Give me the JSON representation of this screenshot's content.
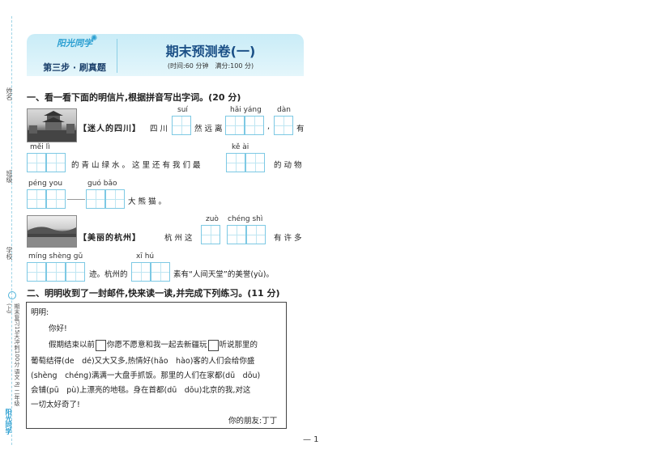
{
  "margin": {
    "name_label": "姓名",
    "class_label": "班级",
    "school_label": "学校",
    "brand": "阳光同学",
    "book_title": "期末复习15天冲刺100分 语文 RJ 二年级(上)"
  },
  "header": {
    "logo_text": "阳光同学",
    "step_label": "第三步 · 刷真题",
    "title": "期末预测卷(一)",
    "subtitle": "(时间:60 分钟　满分:100 分)"
  },
  "section1": {
    "heading": "一、看一看下面的明信片,根据拼音写出字词。(20 分)",
    "card1_tag": "【迷人的四川】",
    "p_sui": "suí",
    "p_haiyang": "hǎi yáng",
    "p_dan": "dàn",
    "t1": "四川",
    "t2": "然远离",
    "t3": ",",
    "t4": "有",
    "p_meili": "měi lì",
    "p_keai": "kě ài",
    "t5": "的青山绿水。这里还有我们最",
    "t6": "的动物",
    "p_pengyou": "péng you",
    "p_guobao": "guó bǎo",
    "t7": "大熊猫。",
    "card2_tag": "【美丽的杭州】",
    "t8": "杭州这",
    "p_zuo": "zuò",
    "p_chengshi": "chéng shì",
    "t9": "有许多",
    "p_mingshenggu": "míng shèng gǔ",
    "p_xihu": "xī hú",
    "t10": "迹。杭州的",
    "t11": "素有“人间天堂”的美誉(yù)。"
  },
  "section2": {
    "heading": "二、明明收到了一封邮件,快来读一读,并完成下列练习。(11 分)",
    "lines": [
      "明明:",
      "你好!",
      "假期结束以前",
      "你愿不愿意和我一起去新疆玩",
      "听说那里的",
      "葡萄结得(de　dé)又大又多,热情好(hǎo　hào)客的人们会给你盛",
      "(shèng　chéng)满满一大盘手抓饭。那里的人们在家都(dū　dōu)",
      "会铺(pū　pù)上漂亮的地毯。身在首都(dū　dōu)北京的我,对这",
      "一切太好奇了!",
      "你的朋友:丁丁"
    ]
  },
  "page_number": "— 1"
}
